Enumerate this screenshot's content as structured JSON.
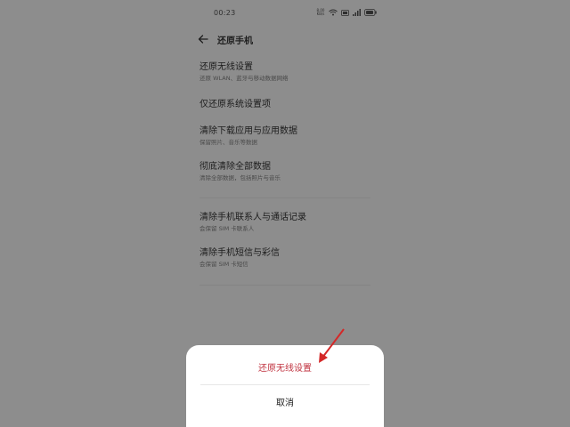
{
  "status_bar": {
    "time": "00:23",
    "speed": "8.00 KB/s",
    "icons": [
      "data-speed",
      "wifi-icon",
      "hd-icon",
      "signal-icon",
      "battery-icon"
    ]
  },
  "header": {
    "title": "还原手机",
    "back_icon": "back-arrow-icon"
  },
  "items": [
    {
      "title": "还原无线设置",
      "subtitle": "还原 WLAN、蓝牙与移动数据网络"
    },
    {
      "title": "仅还原系统设置项",
      "subtitle": ""
    },
    {
      "title": "清除下载应用与应用数据",
      "subtitle": "保留照片、音乐等数据"
    },
    {
      "title": "彻底清除全部数据",
      "subtitle": "清除全部数据，包括照片与音乐"
    },
    {
      "title": "清除手机联系人与通话记录",
      "subtitle": "会保留 SIM 卡联系人"
    },
    {
      "title": "清除手机短信与彩信",
      "subtitle": "会保留 SIM 卡短信"
    }
  ],
  "sheet": {
    "confirm_label": "还原无线设置",
    "cancel_label": "取消"
  },
  "colors": {
    "overlay": "#8d8d8d",
    "danger": "#c0323f",
    "arrow": "#d42828"
  }
}
